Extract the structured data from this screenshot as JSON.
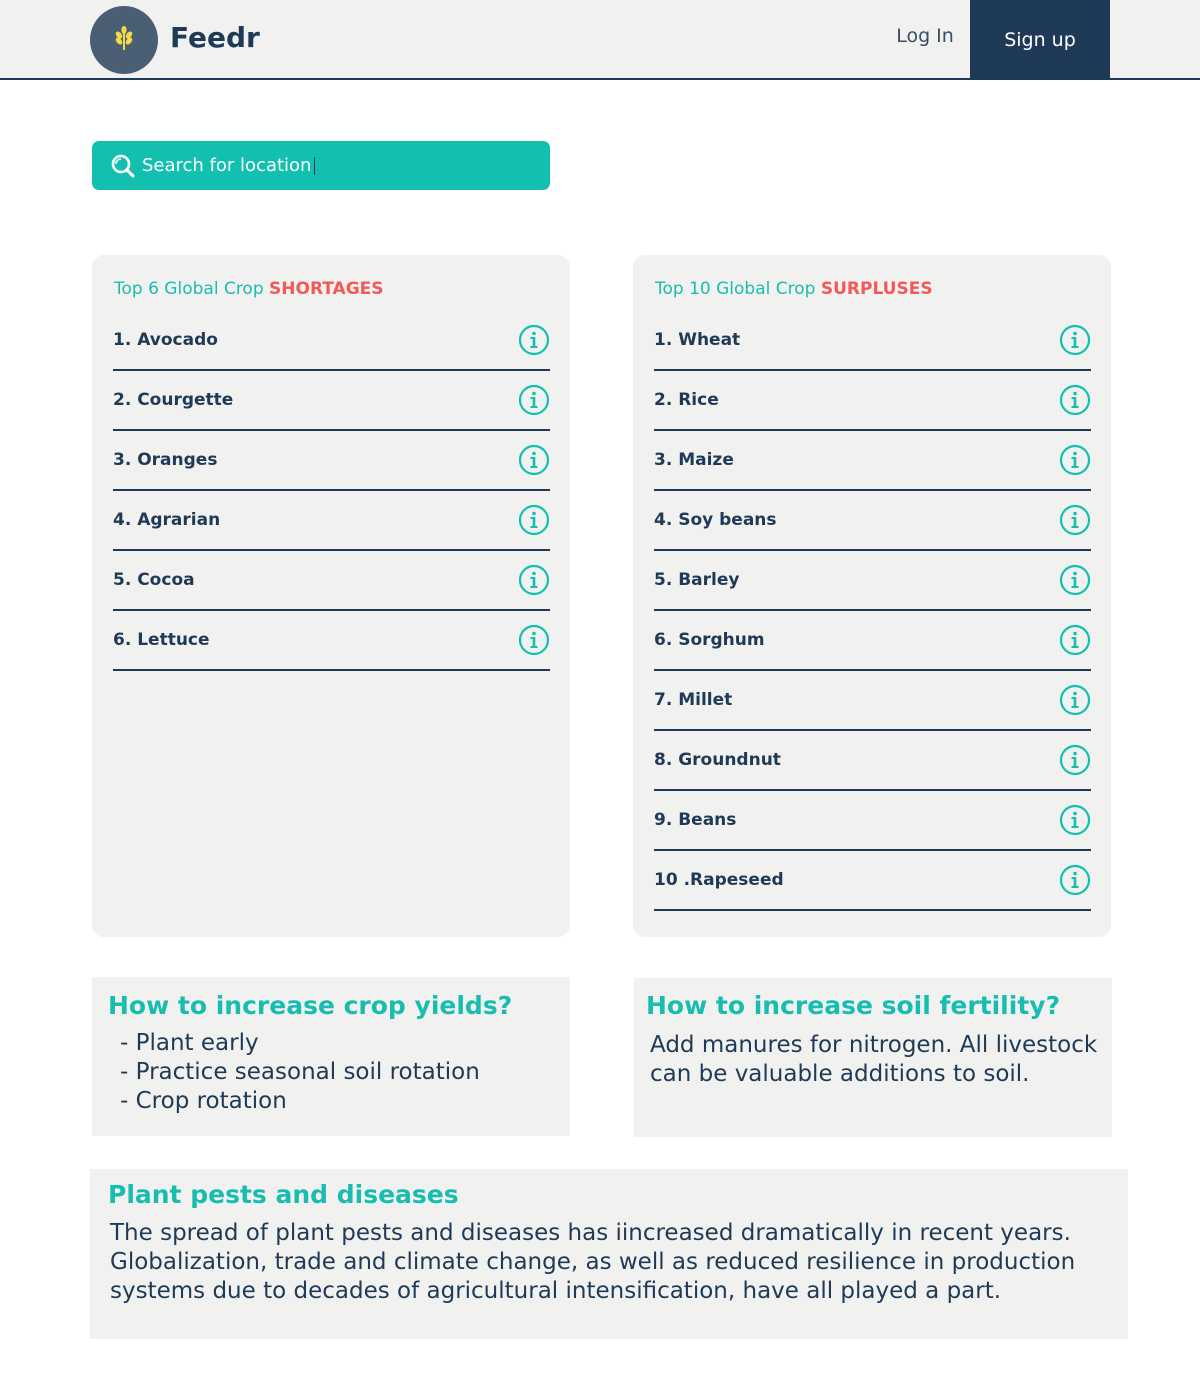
{
  "header": {
    "brand": "Feedr",
    "login_label": "Log In",
    "signup_label": "Sign up"
  },
  "search": {
    "placeholder": "Search for location"
  },
  "shortages": {
    "title_prefix": "Top 6 Global Crop",
    "title_accent": "SHORTAGES",
    "items": [
      "1. Avocado",
      "2. Courgette",
      "3. Oranges",
      "4. Agrarian",
      "5. Cocoa",
      "6. Lettuce"
    ]
  },
  "surpluses": {
    "title_prefix": "Top 10 Global Crop",
    "title_accent": "SURPLUSES",
    "items": [
      "1. Wheat",
      "2. Rice",
      "3. Maize",
      "4. Soy beans",
      "5. Barley",
      "6. Sorghum",
      "7. Millet",
      "8. Groundnut",
      "9. Beans",
      "10 .Rapeseed"
    ]
  },
  "yields": {
    "title": "How to increase crop yields?",
    "tips": [
      "- Plant early",
      "- Practice seasonal soil rotation",
      "- Crop rotation"
    ]
  },
  "soil": {
    "title": "How to increase soil fertility?",
    "body": "Add manures for nitrogen. All livestock can be valuable additions to soil."
  },
  "pests": {
    "title": "Plant pests and diseases",
    "body": "The spread of plant pests and diseases has iincreased dramatically in recent years. Globalization, trade and climate change, as well as reduced resilience in production systems due to decades of agricultural intensification, have all played a part."
  },
  "icons": {
    "logo": "wheat-icon",
    "search": "search-icon",
    "info": "info-icon"
  },
  "colors": {
    "navy": "#1f3a56",
    "teal": "#13c0b0",
    "accent_red": "#f05a5a",
    "panel_bg": "#f1f1f0",
    "logo_wheat": "#f3d84a"
  }
}
